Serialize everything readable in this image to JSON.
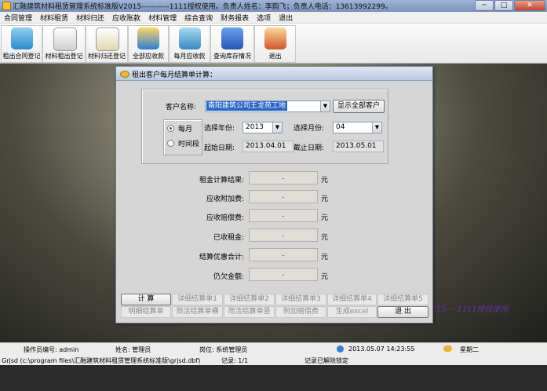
{
  "window": {
    "title": "汇融建筑材料租赁管理系统标准版V2015-----------1111授权使用。负责人姓名：李韵飞；负责人电话：13613992299。",
    "min_label": "─",
    "max_label": "□",
    "close_label": "✕"
  },
  "menu": [
    "合同管理",
    "材料租赁",
    "材料归还",
    "应收账款",
    "材料管理",
    "综合查询",
    "财务报表",
    "选项",
    "退出"
  ],
  "toolbar": {
    "contract": "租出合同登记",
    "rent_out": "材料租出登记",
    "return": "材料归还登记",
    "all_receivable": "全部应收款",
    "monthly_receivable": "每月应收款",
    "stock": "查询库存情况",
    "exit": "退出"
  },
  "dialog": {
    "title": "租出客户每月结算单计算：",
    "customer_label": "客户名称:",
    "customer_value": "南阳建筑公司王龙苑工地",
    "show_all_button": "显示全部客户",
    "mode_monthly": "每月",
    "mode_period": "时间段",
    "year_label": "选择年份:",
    "year_value": "2013",
    "month_label": "选择月份:",
    "month_value": "04",
    "start_label": "起始日期:",
    "start_value": "2013.04.01",
    "end_label": "截止日期:",
    "end_value": "2013.05.01",
    "results": [
      {
        "label": "租金计算结果:",
        "value": "."
      },
      {
        "label": "应收附加费:",
        "value": "."
      },
      {
        "label": "应收赔偿费:",
        "value": "."
      },
      {
        "label": "已收租金:",
        "value": "."
      },
      {
        "label": "结算优惠合计:",
        "value": "."
      },
      {
        "label": "仍欠金额:",
        "value": "."
      }
    ],
    "unit": "元",
    "buttons_row1": [
      "计  算",
      "详细结算单1",
      "详细结算单2",
      "详细结算单3",
      "详细结算单4",
      "详细结算单5"
    ],
    "buttons_row2": [
      "明细结算单",
      "简洁结算单横",
      "简洁结算单竖",
      "附加赔偿费",
      "生成excel",
      "退  出"
    ]
  },
  "watermark": "V2015----1111授权使用",
  "status": {
    "operator": "操作员编号: admin",
    "name": "姓名: 管理员",
    "post": "岗位: 系统管理员",
    "datetime": "2013.05.07  14:23:55",
    "weekday": "星期二",
    "path": "Grjsd (c:\\program files\\汇融建筑材料租赁管理系统标准版\\grjsd.dbf)",
    "record": "记录: 1/1",
    "lock": "记录已解除锁定"
  }
}
